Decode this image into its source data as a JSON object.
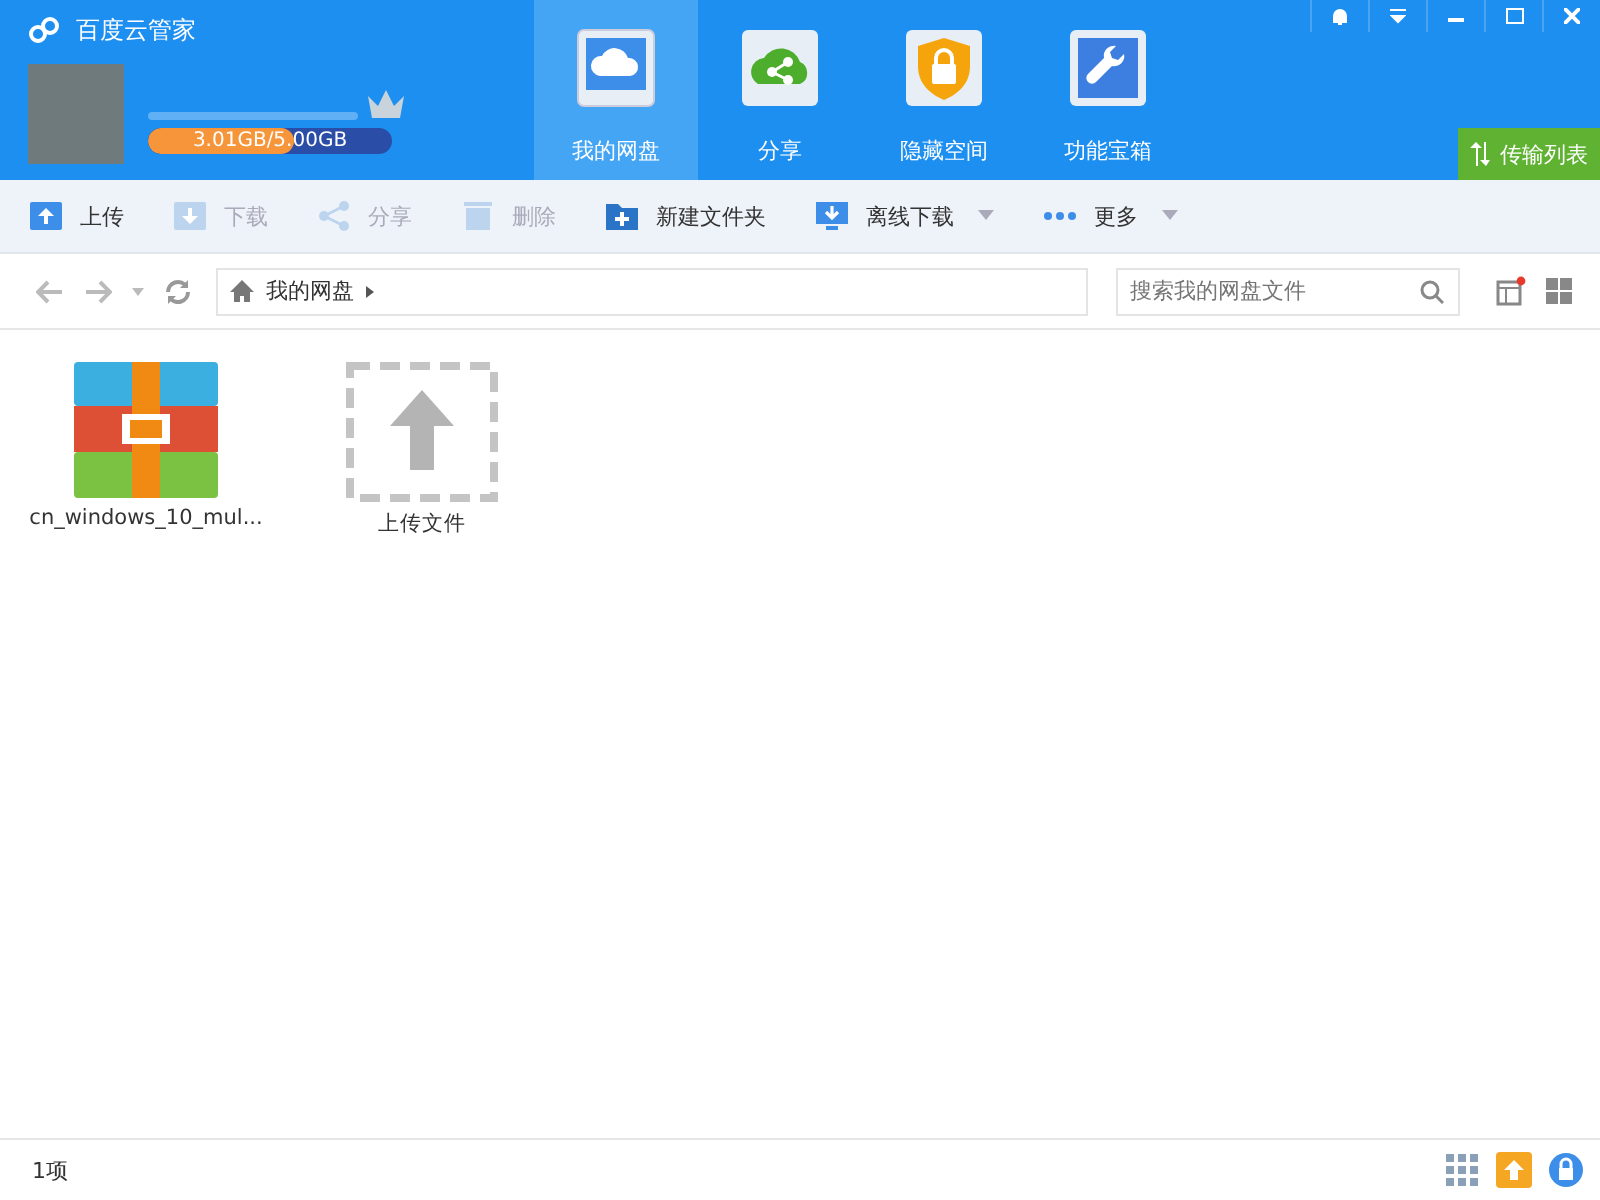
{
  "app_title": "百度云管家",
  "account": {
    "storage": "3.01GB/5.00GB",
    "level": 0.6
  },
  "nav_tabs": [
    {
      "label": "我的网盘",
      "kind": "cloud",
      "selected": true
    },
    {
      "label": "分享",
      "kind": "share",
      "selected": false
    },
    {
      "label": "隐藏空间",
      "kind": "lock",
      "selected": false
    },
    {
      "label": "功能宝箱",
      "kind": "tools",
      "selected": false
    }
  ],
  "transfer_button": "传输列表",
  "toolbar": [
    {
      "label": "上传",
      "kind": "upload",
      "disabled": false,
      "dropdown": false
    },
    {
      "label": "下载",
      "kind": "download",
      "disabled": true,
      "dropdown": false
    },
    {
      "label": "分享",
      "kind": "share",
      "disabled": true,
      "dropdown": false
    },
    {
      "label": "删除",
      "kind": "delete",
      "disabled": true,
      "dropdown": false
    },
    {
      "label": "新建文件夹",
      "kind": "folder",
      "disabled": false,
      "dropdown": false
    },
    {
      "label": "离线下载",
      "kind": "offline",
      "disabled": false,
      "dropdown": true
    },
    {
      "label": "更多",
      "kind": "more",
      "disabled": false,
      "dropdown": true
    }
  ],
  "breadcrumb": "我的网盘",
  "search": {
    "placeholder": "搜索我的网盘文件"
  },
  "files": [
    {
      "name": "cn_windows_10_mul...",
      "kind": "archive"
    },
    {
      "name": "上传文件",
      "kind": "upload"
    }
  ],
  "status_bar": {
    "count": "1项"
  }
}
